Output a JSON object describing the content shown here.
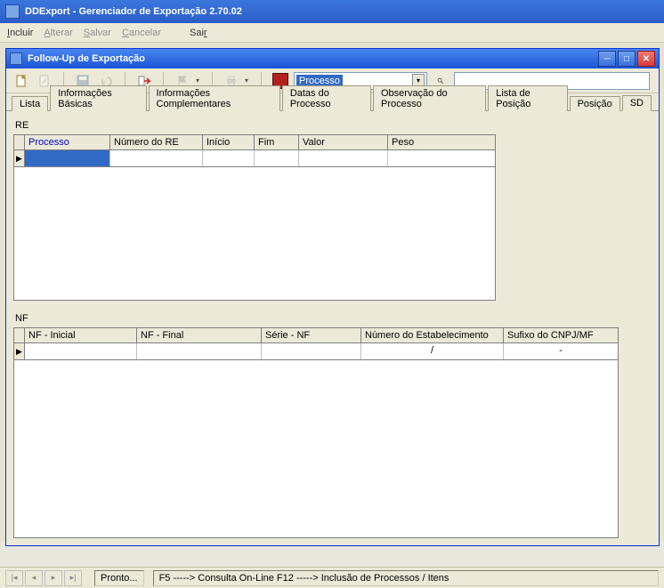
{
  "app": {
    "title": "DDExport - Gerenciador de Exportação 2.70.02"
  },
  "menu": {
    "items": [
      "Incluir",
      "Alterar",
      "Salvar",
      "Cancelar",
      "Sair"
    ]
  },
  "child": {
    "title": "Follow-Up de Exportação"
  },
  "toolbar": {
    "search_select": "Processo"
  },
  "tabs": [
    "Lista",
    "Informações Básicas",
    "Informações Complementares",
    "Datas do Processo",
    "Observação do Processo",
    "Lista de Posição",
    "Posição",
    "SD"
  ],
  "re": {
    "title": "RE",
    "headers": [
      "Processo",
      "Número do RE",
      "Início",
      "Fim",
      "Valor",
      "Peso"
    ],
    "row": [
      "",
      "",
      "",
      "",
      "",
      ""
    ]
  },
  "nf": {
    "title": "NF",
    "headers": [
      "NF - Inicial",
      "NF - Final",
      "Série - NF",
      "Número do Estabelecimento",
      "Sufixo do CNPJ/MF"
    ],
    "row": [
      "",
      "",
      "",
      "/",
      "-"
    ]
  },
  "status": {
    "ready": "Pronto...",
    "hint": "F5  -----> Consulta On-Line  F12 -----> Inclusão de Processos / Itens"
  }
}
